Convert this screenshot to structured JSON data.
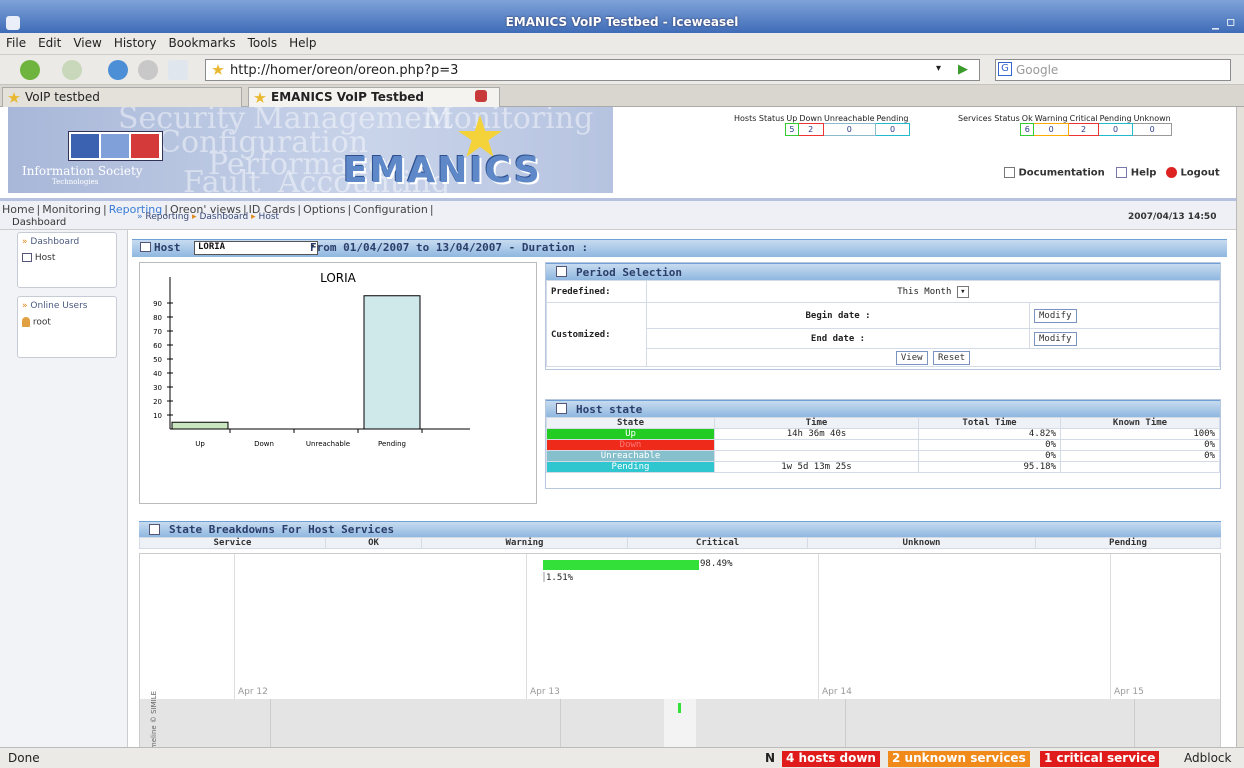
{
  "window": {
    "title": "EMANICS VoIP Testbed - Iceweasel"
  },
  "menubar": {
    "items": [
      "File",
      "Edit",
      "View",
      "History",
      "Bookmarks",
      "Tools",
      "Help"
    ]
  },
  "navbar": {
    "url": "http://homer/oreon/oreon.php?p=3",
    "search_placeholder": "Google"
  },
  "tabs": [
    {
      "label": "VoIP testbed",
      "active": false
    },
    {
      "label": "EMANICS VoIP Testbed",
      "active": true
    }
  ],
  "banner": {
    "brand": "EMANICS",
    "org": "Information Society",
    "org_sub": "Technologies",
    "watermark": [
      "Security",
      "Management",
      "Monitoring",
      "Configuration",
      "Performance",
      "Fault",
      "Accounting"
    ]
  },
  "hosts_status": {
    "label": "Hosts Status",
    "headers": [
      "Up",
      "Down",
      "Unreachable",
      "Pending"
    ],
    "values": [
      "5",
      "2",
      "0",
      "0"
    ]
  },
  "services_status": {
    "label": "Services Status",
    "headers": [
      "Ok",
      "Warning",
      "Critical",
      "Pending",
      "Unknown"
    ],
    "values": [
      "6",
      "0",
      "2",
      "0",
      "0"
    ]
  },
  "toplinks": {
    "documentation": "Documentation",
    "help": "Help",
    "logout": "Logout"
  },
  "mainnav": [
    "Home",
    "Monitoring",
    "Reporting",
    "Oreon' views",
    "ID Cards",
    "Options",
    "Configuration"
  ],
  "sublabel": "Dashboard",
  "left": {
    "dashboard_title": "Dashboard",
    "dashboard_item": "Host",
    "users_title": "Online Users",
    "users_item": "root"
  },
  "breadcrumb": [
    "Reporting",
    "Dashboard",
    "Host"
  ],
  "datetime": "2007/04/13 14:50",
  "hostbar": {
    "label": "Host",
    "selected_host": "LORIA",
    "range": "From 01/04/2007 to 13/04/2007 - Duration :"
  },
  "chart_data": {
    "type": "bar",
    "title": "LORIA",
    "categories": [
      "Up",
      "Down",
      "Unreachable",
      "Pending"
    ],
    "values": [
      4.82,
      0,
      0,
      95.18
    ],
    "ylim": [
      0,
      100
    ],
    "yticks": [
      10,
      20,
      30,
      40,
      50,
      60,
      70,
      80,
      90
    ],
    "colors": {
      "Up": "#c9e6c0",
      "Down": "#ffffff",
      "Unreachable": "#ffffff",
      "Pending": "#cfe8ea"
    }
  },
  "period": {
    "title": "Period Selection",
    "predefined_label": "Predefined:",
    "predefined_value": "This Month",
    "customized_label": "Customized:",
    "begin_label": "Begin date :",
    "end_label": "End date :",
    "modify": "Modify",
    "view": "View",
    "reset": "Reset"
  },
  "host_state": {
    "title": "Host state",
    "headers": [
      "State",
      "Time",
      "Total Time",
      "Known Time"
    ],
    "rows": [
      {
        "state": "Up",
        "color": "#22cc22",
        "time": "14h 36m 40s",
        "total": "4.82%",
        "known": "100%"
      },
      {
        "state": "Down",
        "color": "#ee2a1a",
        "time": "",
        "total": "0%",
        "known": "0%"
      },
      {
        "state": "Unreachable",
        "color": "#86c0cc",
        "time": "",
        "total": "0%",
        "known": "0%"
      },
      {
        "state": "Pending",
        "color": "#2fc6cf",
        "time": "1w 5d 13m 25s",
        "total": "95.18%",
        "known": ""
      }
    ]
  },
  "services": {
    "title": "State Breakdowns For Host Services",
    "headers": [
      "Service",
      "OK",
      "Warning",
      "Critical",
      "Unknown",
      "Pending"
    ]
  },
  "timeline": {
    "bar_label_a": "98.49%",
    "bar_label_b": "1.51%",
    "dates": [
      "Apr 12",
      "Apr 13",
      "Apr 14",
      "Apr 15"
    ],
    "credit": "Timeline © SIMILE"
  },
  "statusbar": {
    "text": "Done",
    "n": "N",
    "down": "4 hosts down",
    "unknown": "2 unknown services",
    "critical": "1 critical service",
    "adblock": "Adblock"
  }
}
